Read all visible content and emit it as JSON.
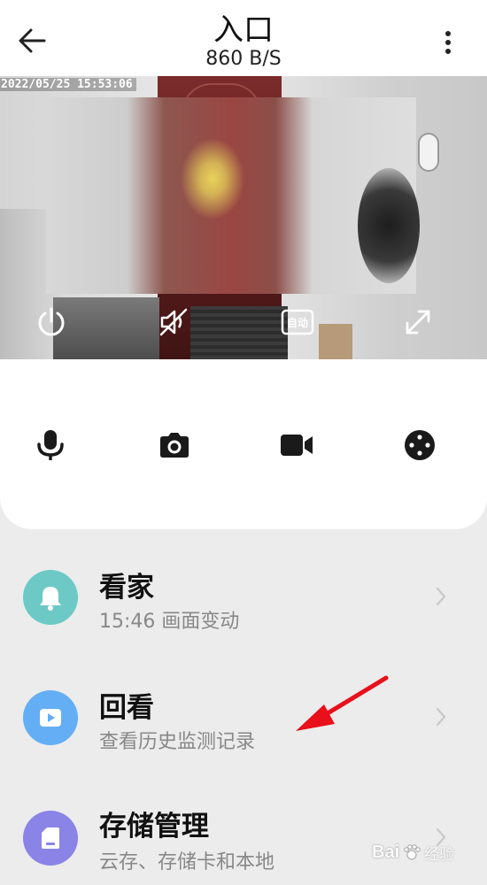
{
  "header": {
    "title": "入口",
    "subtitle": "860 B/S"
  },
  "video": {
    "timestamp": "2022/05/25  15:53:06",
    "auto_label": "自动"
  },
  "controls": [
    {
      "name": "microphone-icon"
    },
    {
      "name": "camera-icon"
    },
    {
      "name": "video-record-icon"
    },
    {
      "name": "direction-pad-icon"
    }
  ],
  "list": [
    {
      "title": "看家",
      "subtitle": "15:46 画面变动",
      "icon": "bell-icon",
      "color": "#6cc9c6"
    },
    {
      "title": "回看",
      "subtitle": "查看历史监测记录",
      "icon": "playback-icon",
      "color": "#63aef4"
    },
    {
      "title": "存储管理",
      "subtitle": "云存、存储卡和本地",
      "icon": "storage-card-icon",
      "color": "#8a84e6"
    }
  ],
  "annotation": {
    "arrow_color": "#e8101a"
  },
  "watermark": {
    "brand": "Bai",
    "suffix": "经验"
  }
}
